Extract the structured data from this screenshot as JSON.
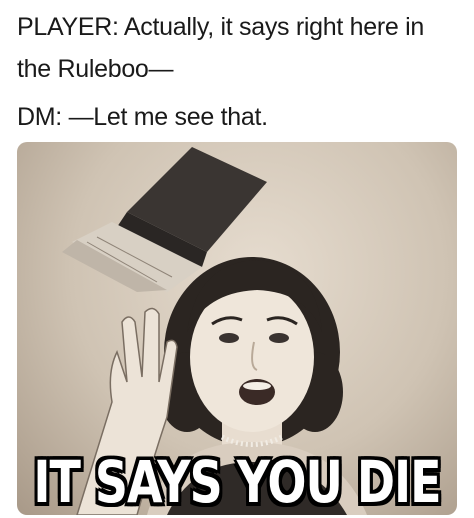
{
  "caption": {
    "player_line": "PLAYER: Actually, it says right here in the Ruleboo—",
    "dm_line": "DM: —Let me see that."
  },
  "meme_image": {
    "overlay_text": "IT SAYS YOU DIE",
    "subject": "vintage-illustration-woman-tossing-book"
  },
  "colors": {
    "background": "#ffffff",
    "caption_text": "#1a1a1a",
    "image_tone": "#cfc3b3",
    "overlay_fill": "#ffffff",
    "overlay_stroke": "#000000"
  }
}
